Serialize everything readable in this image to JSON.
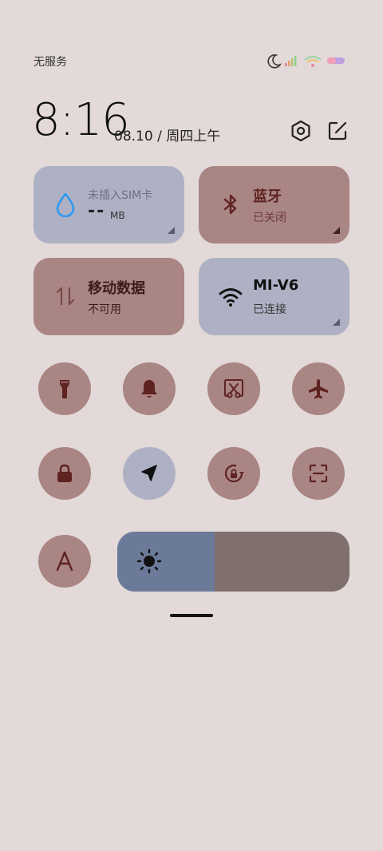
{
  "status_bar": {
    "carrier": "无服务",
    "icons": [
      "moon-icon",
      "signal-icon",
      "wifi-icon",
      "battery-icon"
    ]
  },
  "header": {
    "time": "8:16",
    "date": "08.10 / 周四上午",
    "settings_icon": "settings-hexagon-icon",
    "edit_icon": "edit-icon"
  },
  "tiles": {
    "data_usage": {
      "title": "未插入SIM卡",
      "value": "--",
      "unit": "MB",
      "icon": "water-drop-icon"
    },
    "bluetooth": {
      "title": "蓝牙",
      "status": "已关闭",
      "icon": "bluetooth-icon"
    },
    "mobile_data": {
      "title": "移动数据",
      "status": "不可用",
      "icon": "data-arrows-icon"
    },
    "wifi": {
      "title": "MI-V6",
      "status": "已连接",
      "icon": "wifi-icon"
    }
  },
  "toggles": [
    {
      "name": "flashlight",
      "icon": "flashlight-icon",
      "active": false
    },
    {
      "name": "sound",
      "icon": "bell-icon",
      "active": false
    },
    {
      "name": "screenshot",
      "icon": "scissors-screenshot-icon",
      "active": false
    },
    {
      "name": "airplane-mode",
      "icon": "airplane-icon",
      "active": false
    },
    {
      "name": "lock-screen",
      "icon": "lock-icon",
      "active": false
    },
    {
      "name": "location",
      "icon": "location-arrow-icon",
      "active": true
    },
    {
      "name": "rotation-lock",
      "icon": "rotation-lock-icon",
      "active": false
    },
    {
      "name": "scanner",
      "icon": "scan-icon",
      "active": false
    },
    {
      "name": "font-size",
      "icon": "font-a-icon",
      "active": false
    }
  ],
  "brightness": {
    "level": 0.42,
    "icon": "sun-icon"
  },
  "colors": {
    "background": "#e2d9d8",
    "tile_active": "#aeb1c4",
    "tile_inactive": "#a98584",
    "brightness_fill": "#6c7a9a",
    "brightness_track": "#7f706e",
    "icon_dark": "#5e2320",
    "accent_blue": "#2f9af0"
  }
}
